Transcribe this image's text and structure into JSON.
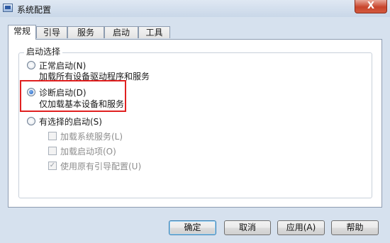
{
  "window": {
    "title": "系统配置",
    "close_symbol": "X"
  },
  "tabs": [
    {
      "label": "常规",
      "active": true
    },
    {
      "label": "引导",
      "active": false
    },
    {
      "label": "服务",
      "active": false
    },
    {
      "label": "启动",
      "active": false
    },
    {
      "label": "工具",
      "active": false
    }
  ],
  "group": {
    "label": "启动选择"
  },
  "options": {
    "normal": {
      "label": "正常启动(N)",
      "description": "加载所有设备驱动程序和服务",
      "selected": false
    },
    "diagnostic": {
      "label": "诊断启动(D)",
      "description": "仅加载基本设备和服务",
      "selected": true
    },
    "selective": {
      "label": "有选择的启动(S)",
      "selected": false
    }
  },
  "checkboxes": [
    {
      "label": "加载系统服务(L)",
      "checked": false
    },
    {
      "label": "加载启动项(O)",
      "checked": false
    },
    {
      "label": "使用原有引导配置(U)",
      "checked": true
    }
  ],
  "buttons": {
    "ok": "确定",
    "cancel": "取消",
    "apply": "应用(A)",
    "help": "帮助"
  },
  "colors": {
    "highlight_box": "#e02020",
    "default_button_border": "#3c7fb1"
  }
}
